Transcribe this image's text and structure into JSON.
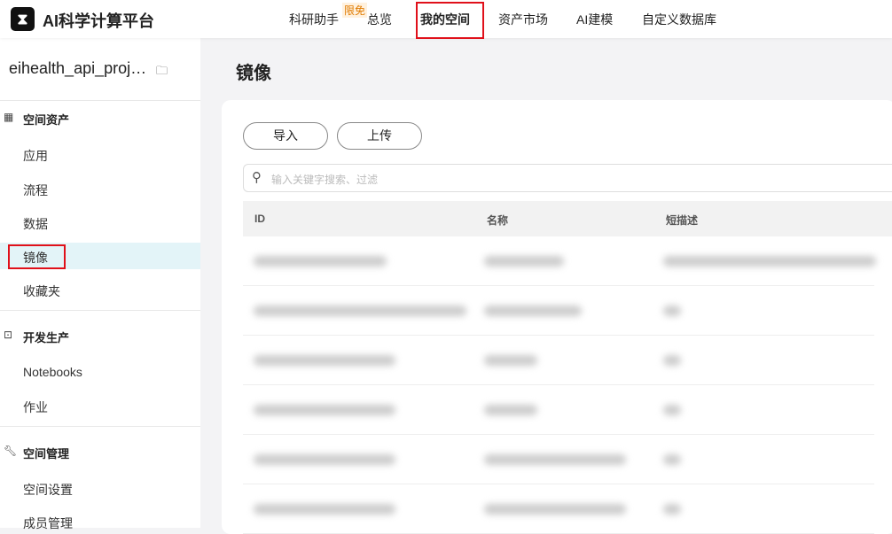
{
  "header": {
    "logo_glyph": "⧗",
    "brand": "AI科学计算平台",
    "nav": [
      {
        "label": "科研助手",
        "badge": "限免"
      },
      {
        "label": "总览"
      },
      {
        "label": "我的空间",
        "active": true
      },
      {
        "label": "资产市场"
      },
      {
        "label": "AI建模"
      },
      {
        "label": "自定义数据库"
      }
    ]
  },
  "sidebar": {
    "project": "eihealth_api_proj…",
    "sections": [
      {
        "title": "空间资产",
        "icon": "grid-icon",
        "items": [
          "应用",
          "流程",
          "数据",
          "镜像",
          "收藏夹"
        ]
      },
      {
        "title": "开发生产",
        "icon": "terminal-icon",
        "items": [
          "Notebooks",
          "作业"
        ]
      },
      {
        "title": "空间管理",
        "icon": "wrench-icon",
        "items": [
          "空间设置",
          "成员管理"
        ]
      }
    ],
    "selected": "镜像"
  },
  "main": {
    "title": "镜像",
    "buttons": {
      "import": "导入",
      "upload": "上传"
    },
    "search_placeholder": "输入关键字搜索、过滤",
    "columns": [
      "ID",
      "名称",
      "短描述"
    ]
  },
  "colors": {
    "highlight": "#e0101a",
    "selected_bg": "#e3f4f8"
  }
}
